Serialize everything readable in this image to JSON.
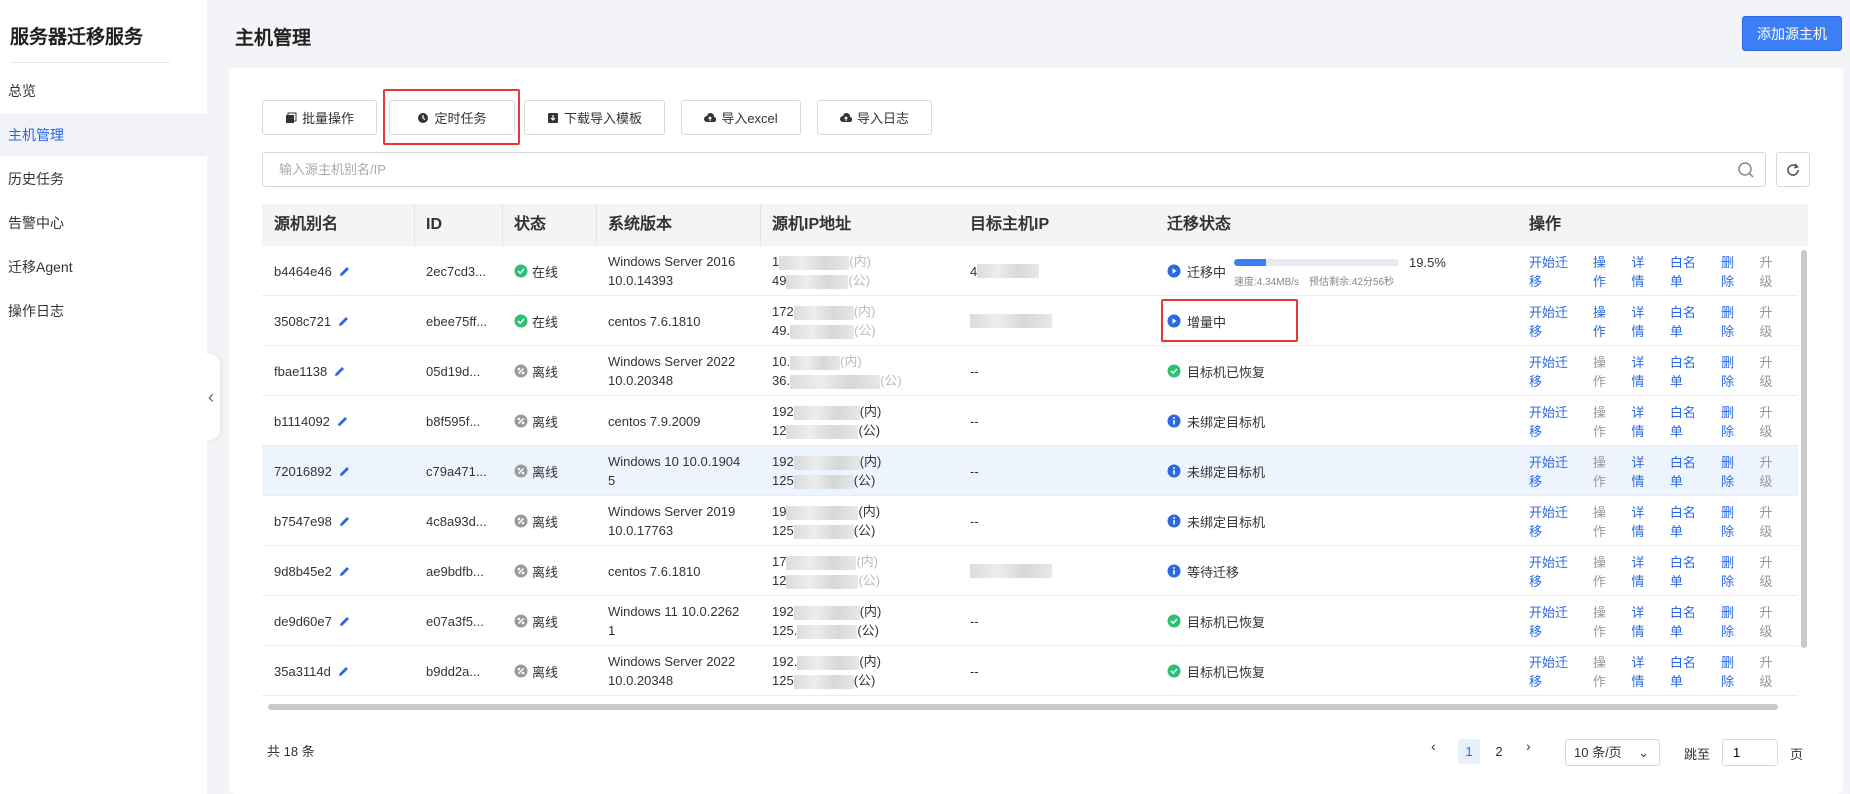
{
  "app_title": "服务器迁移服务",
  "sidebar": {
    "items": [
      {
        "label": "总览"
      },
      {
        "label": "主机管理"
      },
      {
        "label": "历史任务"
      },
      {
        "label": "告警中心"
      },
      {
        "label": "迁移Agent"
      },
      {
        "label": "操作日志"
      }
    ]
  },
  "header": {
    "title": "主机管理",
    "primary_button": "添加源主机"
  },
  "toolbar": {
    "batch": "批量操作",
    "schedule": "定时任务",
    "download_template": "下载导入模板",
    "import_excel": "导入excel",
    "import_log": "导入日志"
  },
  "search": {
    "placeholder": "输入源主机别名/IP"
  },
  "table": {
    "columns": [
      "源机别名",
      "ID",
      "状态",
      "系统版本",
      "源机IP地址",
      "目标主机IP",
      "迁移状态",
      "操作"
    ],
    "rows": [
      {
        "alias": "b4464e46",
        "id": "2ec7cd3...",
        "status": "在线",
        "os1": "Windows Server 2016",
        "os2": "10.0.14393",
        "ip1": "1",
        "ip1s": "(内)",
        "ip2": "49",
        "ip2s": "(公)",
        "target": "4",
        "mig": "迁移中",
        "mig_type": "running"
      },
      {
        "alias": "3508c721",
        "id": "ebee75ff...",
        "status": "在线",
        "os1": "centos 7.6.1810",
        "os2": "",
        "ip1": "172",
        "ip1s": "(内)",
        "ip2": "49.",
        "ip2s": "(公)",
        "target": "",
        "mig": "增量中",
        "mig_type": "running"
      },
      {
        "alias": "fbae1138",
        "id": "05d19d...",
        "status": "离线",
        "os1": "Windows Server 2022",
        "os2": "10.0.20348",
        "ip1": "10.",
        "ip1s": "(内)",
        "ip2": "36.",
        "ip2s": "(公)",
        "target": "--",
        "mig": "目标机已恢复",
        "mig_type": "success"
      },
      {
        "alias": "b1114092",
        "id": "b8f595f...",
        "status": "离线",
        "os1": "centos 7.9.2009",
        "os2": "",
        "ip1": "192",
        "ip1s": "(内)",
        "ip2": "12",
        "ip2s": "(公)",
        "target": "--",
        "mig": "未绑定目标机",
        "mig_type": "info"
      },
      {
        "alias": "72016892",
        "id": "c79a471...",
        "status": "离线",
        "os1": "Windows 10 10.0.1904",
        "os2": "5",
        "ip1": "192",
        "ip1s": "(内)",
        "ip2": "125",
        "ip2s": "(公)",
        "target": "--",
        "mig": "未绑定目标机",
        "mig_type": "info"
      },
      {
        "alias": "b7547e98",
        "id": "4c8a93d...",
        "status": "离线",
        "os1": "Windows Server 2019",
        "os2": "10.0.17763",
        "ip1": "19",
        "ip1s": "(内)",
        "ip2": "125",
        "ip2s": "(公)",
        "target": "--",
        "mig": "未绑定目标机",
        "mig_type": "info"
      },
      {
        "alias": "9d8b45e2",
        "id": "ae9bdfb...",
        "status": "离线",
        "os1": "centos 7.6.1810",
        "os2": "",
        "ip1": "17",
        "ip1s": "(内)",
        "ip2": "12",
        "ip2s": "(公)",
        "target": "",
        "mig": "等待迁移",
        "mig_type": "info"
      },
      {
        "alias": "de9d60e7",
        "id": "e07a3f5...",
        "status": "离线",
        "os1": "Windows 11 10.0.2262",
        "os2": "1",
        "ip1": "192",
        "ip1s": "(内)",
        "ip2": "125.",
        "ip2s": "(公)",
        "target": "--",
        "mig": "目标机已恢复",
        "mig_type": "success"
      },
      {
        "alias": "35a3114d",
        "id": "b9dd2a...",
        "status": "离线",
        "os1": "Windows Server 2022",
        "os2": "10.0.20348",
        "ip1": "192.",
        "ip1s": "(内)",
        "ip2": "125",
        "ip2s": "(公)",
        "target": "--",
        "mig": "目标机已恢复",
        "mig_type": "success"
      }
    ],
    "progress": {
      "value": 0.195,
      "pct": "19.5%",
      "speed": "速度:4.34MB/s",
      "eta": "预估剩余:42分56秒"
    },
    "ops": [
      "开始迁移",
      "操作",
      "详情",
      "白名单",
      "删除",
      "升级"
    ]
  },
  "pagination": {
    "total": "共 18 条",
    "pages": [
      "1",
      "2"
    ],
    "page_size": "10 条/页",
    "jump_label": "跳至",
    "jump_value": "1",
    "page_suffix": "页"
  },
  "colors": {
    "accent": "#2a68e6",
    "primary_button": "#3b7ef5",
    "online": "#2fbf71",
    "offline": "#9a9a9a",
    "highlight": "#e53935"
  }
}
